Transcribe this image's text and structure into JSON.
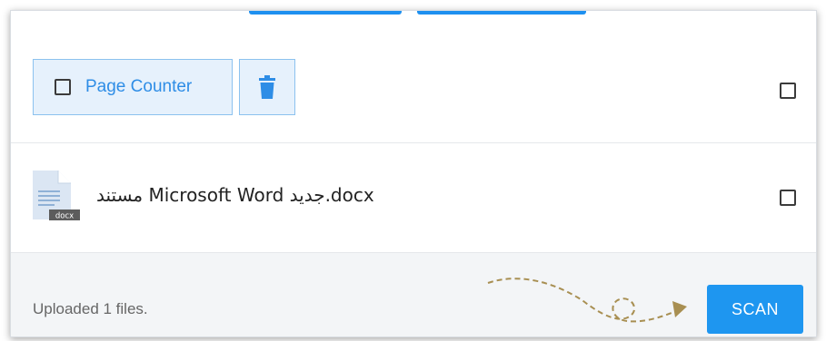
{
  "toolbar": {
    "page_counter_label": "Page Counter"
  },
  "file": {
    "name": "مستند Microsoft Word جديد.docx",
    "ext_badge": "docx"
  },
  "footer": {
    "status_text": "Uploaded 1 files.",
    "scan_label": "SCAN"
  },
  "colors": {
    "accent": "#1e96f0",
    "light_accent_bg": "#e6f1fc",
    "hint_arrow": "#a88f52"
  },
  "icons": [
    "trash-icon",
    "docx-file-icon",
    "checkbox-icon",
    "dashed-arrow-icon"
  ]
}
